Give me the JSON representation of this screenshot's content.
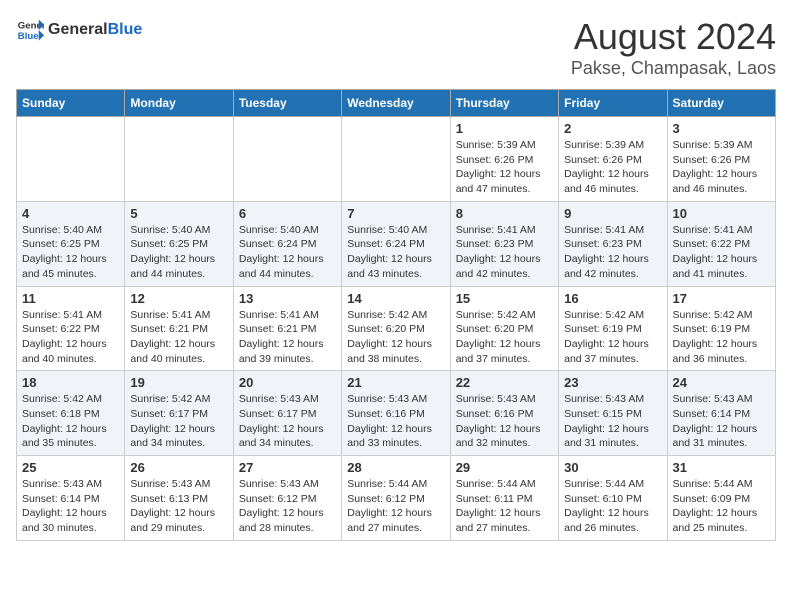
{
  "header": {
    "logo_general": "General",
    "logo_blue": "Blue",
    "month_title": "August 2024",
    "location": "Pakse, Champasak, Laos"
  },
  "days_of_week": [
    "Sunday",
    "Monday",
    "Tuesday",
    "Wednesday",
    "Thursday",
    "Friday",
    "Saturday"
  ],
  "weeks": [
    [
      {
        "day": "",
        "info": ""
      },
      {
        "day": "",
        "info": ""
      },
      {
        "day": "",
        "info": ""
      },
      {
        "day": "",
        "info": ""
      },
      {
        "day": "1",
        "info": "Sunrise: 5:39 AM\nSunset: 6:26 PM\nDaylight: 12 hours\nand 47 minutes."
      },
      {
        "day": "2",
        "info": "Sunrise: 5:39 AM\nSunset: 6:26 PM\nDaylight: 12 hours\nand 46 minutes."
      },
      {
        "day": "3",
        "info": "Sunrise: 5:39 AM\nSunset: 6:26 PM\nDaylight: 12 hours\nand 46 minutes."
      }
    ],
    [
      {
        "day": "4",
        "info": "Sunrise: 5:40 AM\nSunset: 6:25 PM\nDaylight: 12 hours\nand 45 minutes."
      },
      {
        "day": "5",
        "info": "Sunrise: 5:40 AM\nSunset: 6:25 PM\nDaylight: 12 hours\nand 44 minutes."
      },
      {
        "day": "6",
        "info": "Sunrise: 5:40 AM\nSunset: 6:24 PM\nDaylight: 12 hours\nand 44 minutes."
      },
      {
        "day": "7",
        "info": "Sunrise: 5:40 AM\nSunset: 6:24 PM\nDaylight: 12 hours\nand 43 minutes."
      },
      {
        "day": "8",
        "info": "Sunrise: 5:41 AM\nSunset: 6:23 PM\nDaylight: 12 hours\nand 42 minutes."
      },
      {
        "day": "9",
        "info": "Sunrise: 5:41 AM\nSunset: 6:23 PM\nDaylight: 12 hours\nand 42 minutes."
      },
      {
        "day": "10",
        "info": "Sunrise: 5:41 AM\nSunset: 6:22 PM\nDaylight: 12 hours\nand 41 minutes."
      }
    ],
    [
      {
        "day": "11",
        "info": "Sunrise: 5:41 AM\nSunset: 6:22 PM\nDaylight: 12 hours\nand 40 minutes."
      },
      {
        "day": "12",
        "info": "Sunrise: 5:41 AM\nSunset: 6:21 PM\nDaylight: 12 hours\nand 40 minutes."
      },
      {
        "day": "13",
        "info": "Sunrise: 5:41 AM\nSunset: 6:21 PM\nDaylight: 12 hours\nand 39 minutes."
      },
      {
        "day": "14",
        "info": "Sunrise: 5:42 AM\nSunset: 6:20 PM\nDaylight: 12 hours\nand 38 minutes."
      },
      {
        "day": "15",
        "info": "Sunrise: 5:42 AM\nSunset: 6:20 PM\nDaylight: 12 hours\nand 37 minutes."
      },
      {
        "day": "16",
        "info": "Sunrise: 5:42 AM\nSunset: 6:19 PM\nDaylight: 12 hours\nand 37 minutes."
      },
      {
        "day": "17",
        "info": "Sunrise: 5:42 AM\nSunset: 6:19 PM\nDaylight: 12 hours\nand 36 minutes."
      }
    ],
    [
      {
        "day": "18",
        "info": "Sunrise: 5:42 AM\nSunset: 6:18 PM\nDaylight: 12 hours\nand 35 minutes."
      },
      {
        "day": "19",
        "info": "Sunrise: 5:42 AM\nSunset: 6:17 PM\nDaylight: 12 hours\nand 34 minutes."
      },
      {
        "day": "20",
        "info": "Sunrise: 5:43 AM\nSunset: 6:17 PM\nDaylight: 12 hours\nand 34 minutes."
      },
      {
        "day": "21",
        "info": "Sunrise: 5:43 AM\nSunset: 6:16 PM\nDaylight: 12 hours\nand 33 minutes."
      },
      {
        "day": "22",
        "info": "Sunrise: 5:43 AM\nSunset: 6:16 PM\nDaylight: 12 hours\nand 32 minutes."
      },
      {
        "day": "23",
        "info": "Sunrise: 5:43 AM\nSunset: 6:15 PM\nDaylight: 12 hours\nand 31 minutes."
      },
      {
        "day": "24",
        "info": "Sunrise: 5:43 AM\nSunset: 6:14 PM\nDaylight: 12 hours\nand 31 minutes."
      }
    ],
    [
      {
        "day": "25",
        "info": "Sunrise: 5:43 AM\nSunset: 6:14 PM\nDaylight: 12 hours\nand 30 minutes."
      },
      {
        "day": "26",
        "info": "Sunrise: 5:43 AM\nSunset: 6:13 PM\nDaylight: 12 hours\nand 29 minutes."
      },
      {
        "day": "27",
        "info": "Sunrise: 5:43 AM\nSunset: 6:12 PM\nDaylight: 12 hours\nand 28 minutes."
      },
      {
        "day": "28",
        "info": "Sunrise: 5:44 AM\nSunset: 6:12 PM\nDaylight: 12 hours\nand 27 minutes."
      },
      {
        "day": "29",
        "info": "Sunrise: 5:44 AM\nSunset: 6:11 PM\nDaylight: 12 hours\nand 27 minutes."
      },
      {
        "day": "30",
        "info": "Sunrise: 5:44 AM\nSunset: 6:10 PM\nDaylight: 12 hours\nand 26 minutes."
      },
      {
        "day": "31",
        "info": "Sunrise: 5:44 AM\nSunset: 6:09 PM\nDaylight: 12 hours\nand 25 minutes."
      }
    ]
  ]
}
